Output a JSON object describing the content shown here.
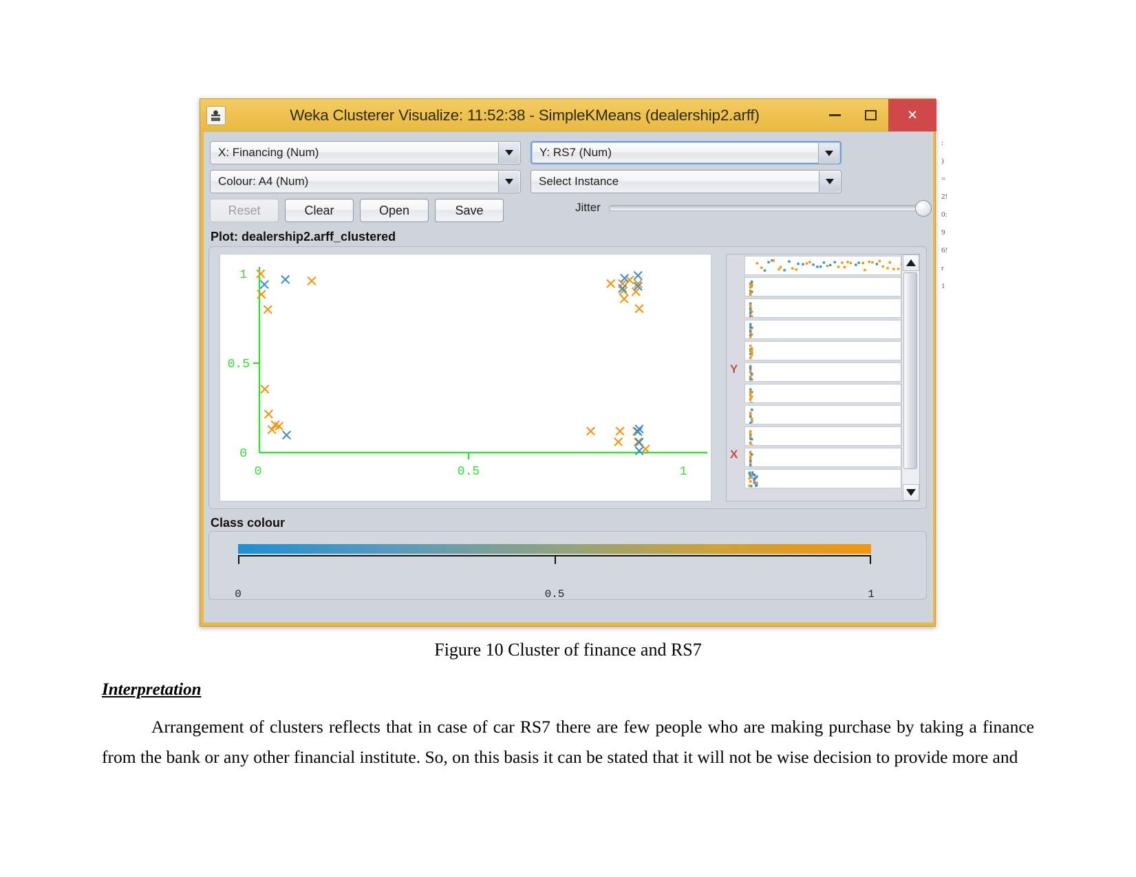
{
  "window": {
    "title": "Weka Clusterer Visualize: 11:52:38 - SimpleKMeans (dealership2.arff)",
    "app_icon": "java-coffee-cup-icon",
    "minimize_label": "–",
    "maximize_label": "□",
    "close_label": "×",
    "titlebar_color": "#eec14f",
    "close_color": "#d0494a"
  },
  "controls": {
    "x_axis_selector": "X: Financing (Num)",
    "y_axis_selector": "Y: RS7 (Num)",
    "colour_selector": "Colour: A4 (Num)",
    "instance_selector": "Select Instance",
    "buttons": [
      {
        "label": "Reset",
        "enabled": false
      },
      {
        "label": "Clear",
        "enabled": true
      },
      {
        "label": "Open",
        "enabled": true
      },
      {
        "label": "Save",
        "enabled": true
      }
    ],
    "jitter_label": "Jitter",
    "jitter_value": 100
  },
  "plot": {
    "title": "Plot: dealership2.arff_clustered"
  },
  "class_colour": {
    "label": "Class colour",
    "ticks": [
      "0",
      "0.5",
      "1"
    ],
    "gradient_start": "#1f8fd4",
    "gradient_end": "#f2960f"
  },
  "attribute_panel": {
    "y_tag": "Y",
    "x_tag": "X",
    "scroll_up": "▲",
    "scroll_down": "▼"
  },
  "document": {
    "figure_caption": "Figure 10 Cluster of finance and RS7",
    "interpretation_heading": "Interpretation",
    "body_paragraph": "Arrangement of clusters reflects that in case of car RS7 there are few people who are making purchase by taking a finance from the bank or any other financial institute. So, on this basis it can be stated that it will not be wise decision to provide more and"
  },
  "chart_data": {
    "type": "scatter",
    "title": "Plot: dealership2.arff_clustered",
    "xlabel": "Financing (Num)",
    "ylabel": "RS7 (Num)",
    "xlim": [
      0,
      1
    ],
    "ylim": [
      0,
      1
    ],
    "xticks": [
      "0",
      "0.5",
      "1"
    ],
    "yticks": [
      "0",
      "0.5",
      "1"
    ],
    "grid": false,
    "axis_color": "#33dd33",
    "marker": "x",
    "legend_position": "none",
    "series": [
      {
        "name": "cluster-orange",
        "color": "#f2960f",
        "points": [
          [
            0.003,
            1.0
          ],
          [
            0.005,
            0.885
          ],
          [
            0.02,
            0.8
          ],
          [
            0.125,
            0.96
          ],
          [
            0.013,
            0.355
          ],
          [
            0.022,
            0.215
          ],
          [
            0.038,
            0.155
          ],
          [
            0.03,
            0.128
          ],
          [
            0.047,
            0.148
          ],
          [
            0.885,
            0.965
          ],
          [
            0.868,
            0.945
          ],
          [
            0.87,
            0.905
          ],
          [
            0.905,
            0.945
          ],
          [
            0.9,
            0.9
          ],
          [
            0.872,
            0.86
          ],
          [
            0.908,
            0.805
          ],
          [
            0.84,
            0.945
          ],
          [
            0.792,
            0.12
          ],
          [
            0.862,
            0.12
          ],
          [
            0.902,
            0.12
          ],
          [
            0.858,
            0.06
          ],
          [
            0.905,
            0.06
          ],
          [
            0.923,
            0.02
          ]
        ]
      },
      {
        "name": "cluster-blue",
        "color": "#3d8fd5",
        "points": [
          [
            0.012,
            0.94
          ],
          [
            0.062,
            0.968
          ],
          [
            0.065,
            0.098
          ],
          [
            0.873,
            0.975
          ],
          [
            0.905,
            0.93
          ],
          [
            0.868,
            0.918
          ],
          [
            0.905,
            0.99
          ],
          [
            0.908,
            0.132
          ],
          [
            0.905,
            0.118
          ],
          [
            0.908,
            0.058
          ],
          [
            0.908,
            0.01
          ]
        ]
      }
    ]
  },
  "background_document": {
    "fragments": [
      ":",
      ")",
      "=",
      "2!",
      "0:",
      "9",
      "6!",
      "r",
      "1"
    ]
  }
}
